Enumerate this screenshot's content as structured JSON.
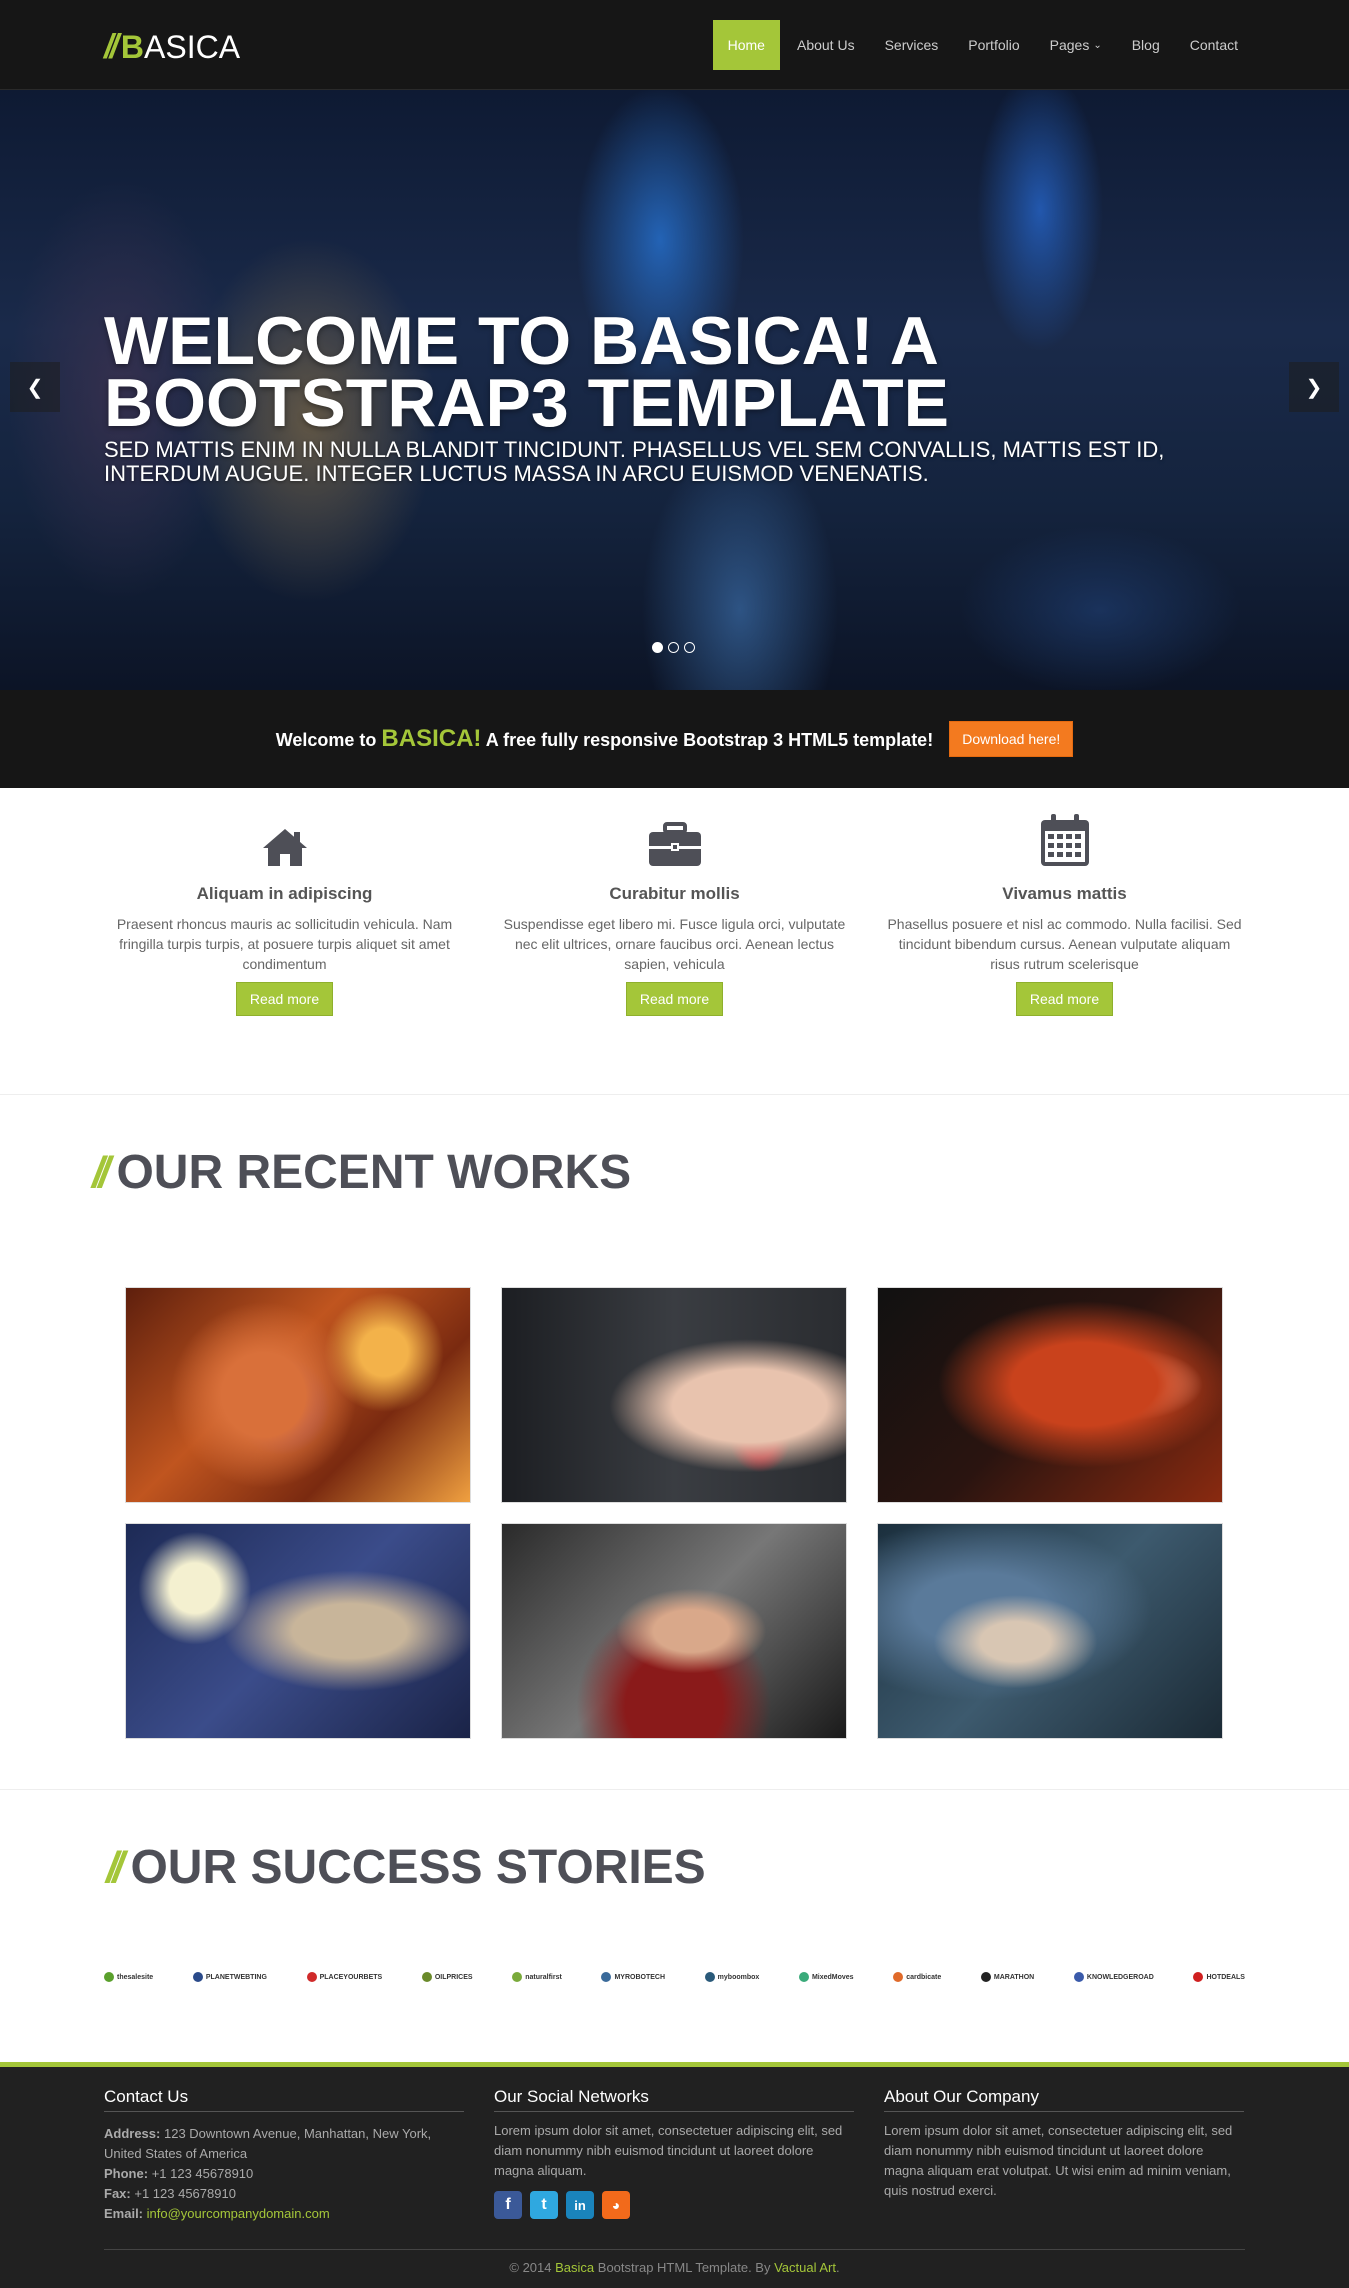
{
  "brand": {
    "logo_mark": "//",
    "logo_first": "B",
    "logo_rest": "ASICA",
    "accent": "#a4c639"
  },
  "nav": {
    "items": [
      {
        "label": "Home",
        "active": true
      },
      {
        "label": "About Us"
      },
      {
        "label": "Services"
      },
      {
        "label": "Portfolio"
      },
      {
        "label": "Pages"
      },
      {
        "label": "Blog"
      },
      {
        "label": "Contact"
      }
    ]
  },
  "hero": {
    "title": "WELCOME TO BASICA! A BOOTSTRAP3 TEMPLATE",
    "subtitle": "Sed mattis enim in nulla blandit tincidunt. Phasellus vel sem convallis, mattis est id, interdum augue. Integer luctus massa in arcu euismod venenatis.",
    "prev_icon": "chevron-left-icon",
    "next_icon": "chevron-right-icon",
    "slides_total": 3,
    "active_slide": 1
  },
  "cta": {
    "pre": "Welcome to",
    "brand": "BASICA!",
    "post": "A free fully responsive Bootstrap 3 HTML5 template!",
    "button": "Download here!",
    "button_color": "#f37a1f"
  },
  "features": [
    {
      "icon": "home-icon",
      "title": "Aliquam in adipiscing",
      "text": "Praesent rhoncus mauris ac sollicitudin vehicula. Nam fringilla turpis turpis, at posuere turpis aliquet sit amet condimentum",
      "button": "Read more"
    },
    {
      "icon": "briefcase-icon",
      "title": "Curabitur mollis",
      "text": "Suspendisse eget libero mi. Fusce ligula orci, vulputate nec elit ultrices, ornare faucibus orci. Aenean lectus sapien, vehicula",
      "button": "Read more"
    },
    {
      "icon": "calendar-icon",
      "title": "Vivamus mattis",
      "text": "Phasellus posuere et nisl ac commodo. Nulla facilisi. Sed tincidunt bibendum cursus. Aenean vulputate aliquam risus rutrum scelerisque",
      "button": "Read more"
    }
  ],
  "works": {
    "title": "OUR RECENT WORKS"
  },
  "stories": {
    "title": "OUR SUCCESS STORIES",
    "logos": [
      "thesalesite",
      "PLANETWEBTING",
      "PLACEYOURBETS",
      "OILPRICES",
      "naturalfirst",
      "MYROBOTECH",
      "myboombox",
      "MixedMoves",
      "cardbicate",
      "MARATHON",
      "KNOWLEDGEROAD",
      "HOTDEALS"
    ]
  },
  "footer": {
    "contact": {
      "title": "Contact Us",
      "address_label": "Address:",
      "address": "123 Downtown Avenue, Manhattan, New York, United States of America",
      "phone_label": "Phone:",
      "phone": "+1 123 45678910",
      "fax_label": "Fax:",
      "fax": "+1 123 45678910",
      "email_label": "Email:",
      "email": "info@yourcompanydomain.com"
    },
    "social": {
      "title": "Our Social Networks",
      "text": "Lorem ipsum dolor sit amet, consectetuer adipiscing elit, sed diam nonummy nibh euismod tincidunt ut laoreet dolore magna aliquam.",
      "icons": [
        "facebook-icon",
        "twitter-icon",
        "linkedin-icon",
        "rss-icon"
      ]
    },
    "about": {
      "title": "About Our Company",
      "text": "Lorem ipsum dolor sit amet, consectetuer adipiscing elit, sed diam nonummy nibh euismod tincidunt ut laoreet dolore magna aliquam erat volutpat. Ut wisi enim ad minim veniam, quis nostrud exerci."
    },
    "copyright_pre": "© 2014",
    "copyright_brand": "Basica",
    "copyright_mid": "Bootstrap HTML Template. By",
    "copyright_author": "Vactual Art",
    "copyright_end": "."
  }
}
